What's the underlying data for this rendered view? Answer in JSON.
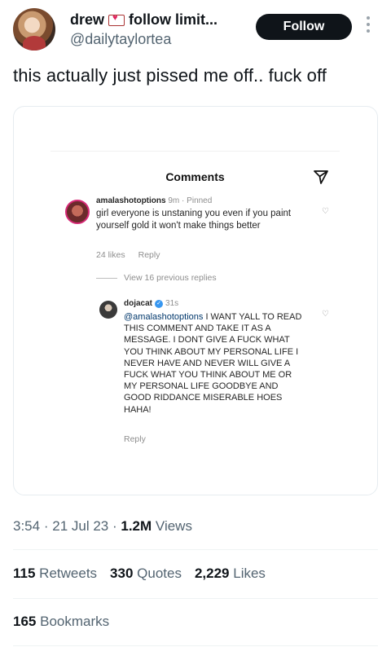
{
  "author": {
    "display_name": "drew",
    "display_name_suffix": "follow limit...",
    "handle": "@dailytaylortea",
    "follow_label": "Follow",
    "avatar_icon": "avatar-image",
    "envelope_icon": "love-letter-icon"
  },
  "tweet": {
    "text": "this actually just pissed me off.. fuck off"
  },
  "media": {
    "header_title": "Comments",
    "send_icon": "paper-plane-icon",
    "comment1": {
      "username": "amalashotoptions",
      "time": "9m",
      "separator": "·",
      "status": "Pinned",
      "text": "girl everyone is unstaning you even if you paint yourself gold it won't make things better",
      "likes": "24 likes",
      "reply": "Reply"
    },
    "view_replies": "View 16 previous replies",
    "comment2": {
      "username": "dojacat",
      "time": "31s",
      "mention": "@amalashotoptions",
      "text": " I WANT YALL TO READ THIS COMMENT AND TAKE IT AS A MESSAGE. I DONT GIVE A FUCK WHAT YOU THINK ABOUT MY PERSONAL LIFE I NEVER HAVE AND NEVER WILL GIVE A FUCK WHAT YOU THINK ABOUT ME OR MY PERSONAL LIFE GOODBYE AND GOOD RIDDANCE MISERABLE HOES HAHA!",
      "reply": "Reply"
    }
  },
  "meta": {
    "time": "3:54",
    "dot1": "·",
    "date": "21 Jul 23",
    "dot2": "·",
    "views_count": "1.2M",
    "views_label": "Views"
  },
  "stats": {
    "retweets_count": "115",
    "retweets_label": "Retweets",
    "quotes_count": "330",
    "quotes_label": "Quotes",
    "likes_count": "2,229",
    "likes_label": "Likes",
    "bookmarks_count": "165",
    "bookmarks_label": "Bookmarks"
  },
  "colors": {
    "text_primary": "#0f1419",
    "text_secondary": "#536471",
    "follow_bg": "#0f1419",
    "mention": "#00376b",
    "verified": "#3897f0"
  }
}
